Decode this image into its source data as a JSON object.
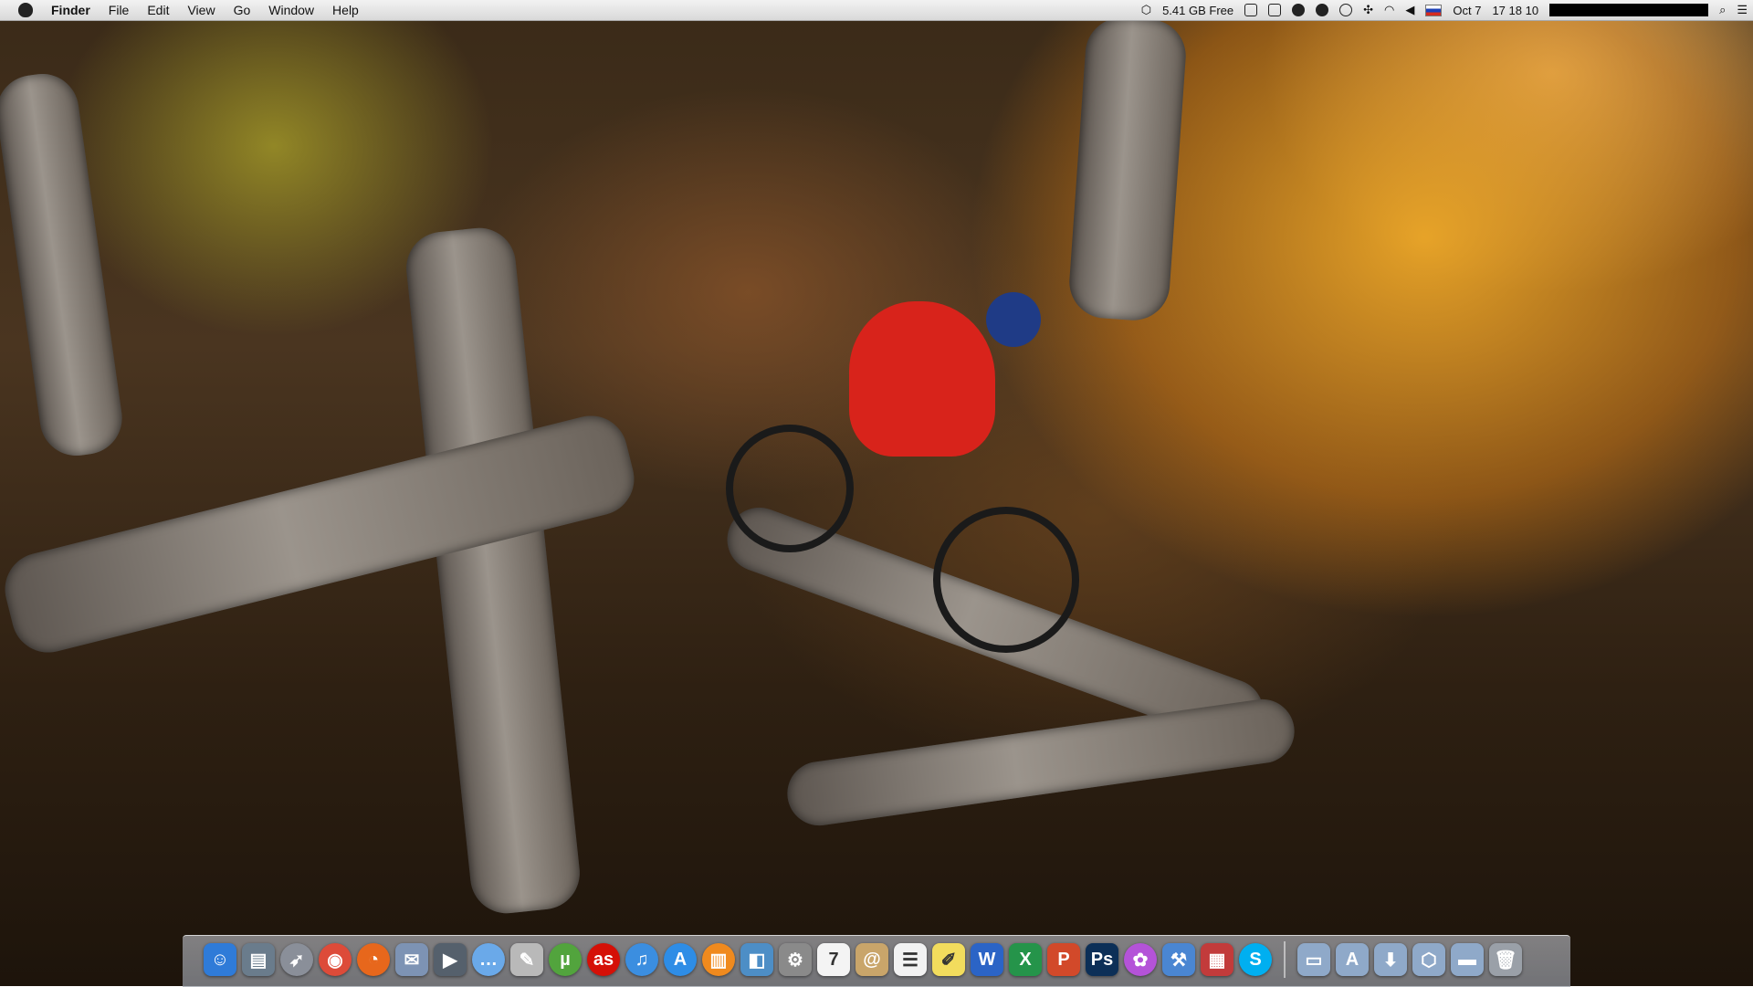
{
  "menubar": {
    "app_name": "Finder",
    "menus": [
      "File",
      "Edit",
      "View",
      "Go",
      "Window",
      "Help"
    ],
    "disk_free": "5.41 GB Free",
    "date": "Oct 7",
    "time": "17 18 10"
  },
  "dock": {
    "apps": [
      {
        "name": "finder",
        "color": "#2f7bd8",
        "glyph": "☺",
        "shape": "square"
      },
      {
        "name": "preview",
        "color": "#6a7c8c",
        "glyph": "▤",
        "shape": "square"
      },
      {
        "name": "launchpad",
        "color": "#8a8f99",
        "glyph": "➶",
        "shape": "circle"
      },
      {
        "name": "chrome",
        "color": "#dd4b39",
        "glyph": "◉",
        "shape": "circle"
      },
      {
        "name": "firefox",
        "color": "#e7671c",
        "glyph": "◔",
        "shape": "circle"
      },
      {
        "name": "mail-stamp",
        "color": "#7d93b4",
        "glyph": "✉",
        "shape": "square"
      },
      {
        "name": "facetime",
        "color": "#55606c",
        "glyph": "▶",
        "shape": "square"
      },
      {
        "name": "messages",
        "color": "#6aa9e9",
        "glyph": "…",
        "shape": "circle"
      },
      {
        "name": "script-editor",
        "color": "#b9b9b9",
        "glyph": "✎",
        "shape": "square"
      },
      {
        "name": "utorrent",
        "color": "#52a43d",
        "glyph": "µ",
        "shape": "circle"
      },
      {
        "name": "lastfm",
        "color": "#d51007",
        "glyph": "as",
        "shape": "circle"
      },
      {
        "name": "itunes",
        "color": "#3b8ee0",
        "glyph": "♫",
        "shape": "circle"
      },
      {
        "name": "app-store",
        "color": "#2e8de6",
        "glyph": "A",
        "shape": "circle"
      },
      {
        "name": "ibooks",
        "color": "#f08a1e",
        "glyph": "▥",
        "shape": "circle"
      },
      {
        "name": "iphoto",
        "color": "#4d8ec6",
        "glyph": "◧",
        "shape": "square"
      },
      {
        "name": "system-preferences",
        "color": "#8a8a8a",
        "glyph": "⚙",
        "shape": "square"
      },
      {
        "name": "calendar",
        "color": "#f4f4f4",
        "glyph": "7",
        "shape": "square"
      },
      {
        "name": "contacts",
        "color": "#c9a56a",
        "glyph": "@",
        "shape": "square"
      },
      {
        "name": "reminders",
        "color": "#f2f2f2",
        "glyph": "☰",
        "shape": "square"
      },
      {
        "name": "stickies",
        "color": "#f2dc5d",
        "glyph": "✐",
        "shape": "square"
      },
      {
        "name": "word",
        "color": "#2b64c6",
        "glyph": "W",
        "shape": "square"
      },
      {
        "name": "excel",
        "color": "#25944a",
        "glyph": "X",
        "shape": "square"
      },
      {
        "name": "powerpoint",
        "color": "#d2492a",
        "glyph": "P",
        "shape": "square"
      },
      {
        "name": "photoshop",
        "color": "#0c2f57",
        "glyph": "Ps",
        "shape": "square"
      },
      {
        "name": "flower",
        "color": "#b453d8",
        "glyph": "✿",
        "shape": "circle"
      },
      {
        "name": "xcode",
        "color": "#4a86d2",
        "glyph": "⚒",
        "shape": "square"
      },
      {
        "name": "photo-booth",
        "color": "#c23b3b",
        "glyph": "▦",
        "shape": "square"
      },
      {
        "name": "skype",
        "color": "#00aff0",
        "glyph": "S",
        "shape": "circle"
      }
    ],
    "folders": [
      {
        "name": "documents",
        "color": "#8fa9c9",
        "glyph": "▭"
      },
      {
        "name": "applications",
        "color": "#8fa9c9",
        "glyph": "A"
      },
      {
        "name": "downloads",
        "color": "#8fa9c9",
        "glyph": "⬇"
      },
      {
        "name": "dropbox",
        "color": "#8fa9c9",
        "glyph": "⬡"
      },
      {
        "name": "desktop",
        "color": "#8fa9c9",
        "glyph": "▬"
      }
    ]
  }
}
